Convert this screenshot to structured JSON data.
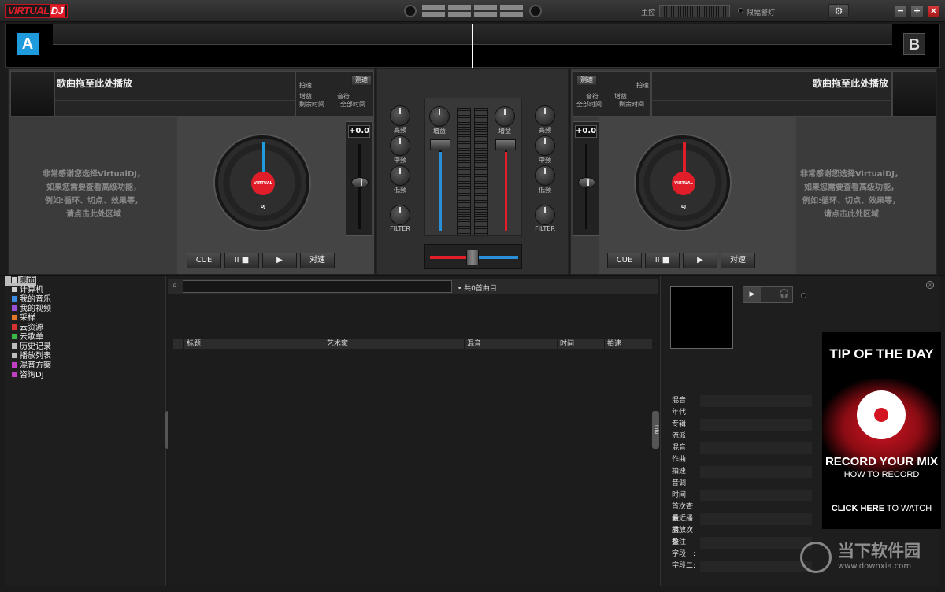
{
  "app": {
    "logo_virtual": "VIRTUAL",
    "logo_dj": "DJ",
    "master_label": "主控",
    "limiter_label": "限幅警灯",
    "window_buttons": {
      "minimize": "−",
      "maximize": "+",
      "close": "×"
    }
  },
  "colors": {
    "deck_a": "#1e9bdc",
    "deck_b_red": "#e11d2a",
    "accent_blue": "#2b8fd8"
  },
  "deck_a": {
    "badge": "A",
    "title_placeholder": "歌曲拖至此处播放",
    "info": {
      "bpm": "拍速",
      "tempo_btn": "测速",
      "gain": "增益",
      "key": "音符",
      "remain": "剩余时间",
      "total": "全部时间"
    },
    "message": [
      "非常感谢您选择VirtualDJ，",
      "如果您需要查看高级功能，",
      "例如:循环、切点、效果等，",
      "请点击此处区域"
    ],
    "pitch": "+0.0",
    "buttons": {
      "cue": "CUE",
      "pause": "II ■",
      "play": "▶",
      "sync": "对速"
    }
  },
  "deck_b": {
    "badge": "B",
    "title_placeholder": "歌曲拖至此处播放",
    "info": {
      "bpm": "拍速",
      "tempo_btn": "测速",
      "gain": "增益",
      "key": "音符",
      "remain": "剩余时间",
      "total": "全部时间"
    },
    "message": [
      "非常感谢您选择VirtualDJ，",
      "如果您需要查看高级功能，",
      "例如:循环、切点、效果等，",
      "请点击此处区域"
    ],
    "pitch": "+0.0",
    "buttons": {
      "cue": "CUE",
      "pause": "II ■",
      "play": "▶",
      "sync": "对速"
    }
  },
  "mixer": {
    "high": "高频",
    "mid": "中频",
    "low": "低频",
    "filter": "FILTER",
    "gain": "增益",
    "headphone": "🎧"
  },
  "browser": {
    "folders": [
      {
        "label": "桌面",
        "color": "#cfcfcf"
      },
      {
        "label": "计算机",
        "color": "#cfcfcf"
      },
      {
        "label": "我的音乐",
        "color": "#3c8be0"
      },
      {
        "label": "我的视频",
        "color": "#9b4fd6"
      },
      {
        "label": "采样",
        "color": "#e0772a"
      },
      {
        "label": "云资源",
        "color": "#d63232"
      },
      {
        "label": "云歌单",
        "color": "#3ab84a"
      },
      {
        "label": "历史记录",
        "color": "#bdbdbd"
      },
      {
        "label": "播放列表",
        "color": "#bdbdbd"
      },
      {
        "label": "混音方案",
        "color": "#c23ec2"
      },
      {
        "label": "咨询DJ",
        "color": "#c23ec2"
      }
    ],
    "folders_tab": "folders",
    "info_tab": "info",
    "search_placeholder": "",
    "track_count": "共0首曲目",
    "columns": [
      "标题",
      "艺术家",
      "混音",
      "时间",
      "拍速"
    ]
  },
  "info_panel": {
    "tags": [
      "混音:",
      "年代:",
      "专辑:",
      "流派:",
      "混音:",
      "作曲:",
      "拍速:",
      "音调:",
      "时间:",
      "首次查看:",
      "最近播放:",
      "播放次数:",
      "备注:",
      "字段一:",
      "字段二:"
    ],
    "preview_play": "▶",
    "preview_hp": "🎧",
    "close": "×"
  },
  "ad": {
    "tip": "TIP OF THE DAY",
    "headline": "RECORD YOUR MIX",
    "sub": "HOW TO RECORD",
    "cta_bold": "CLICK HERE",
    "cta_rest": " TO WATCH"
  },
  "watermark": {
    "name": "当下软件园",
    "url": "www.downxia.com"
  }
}
